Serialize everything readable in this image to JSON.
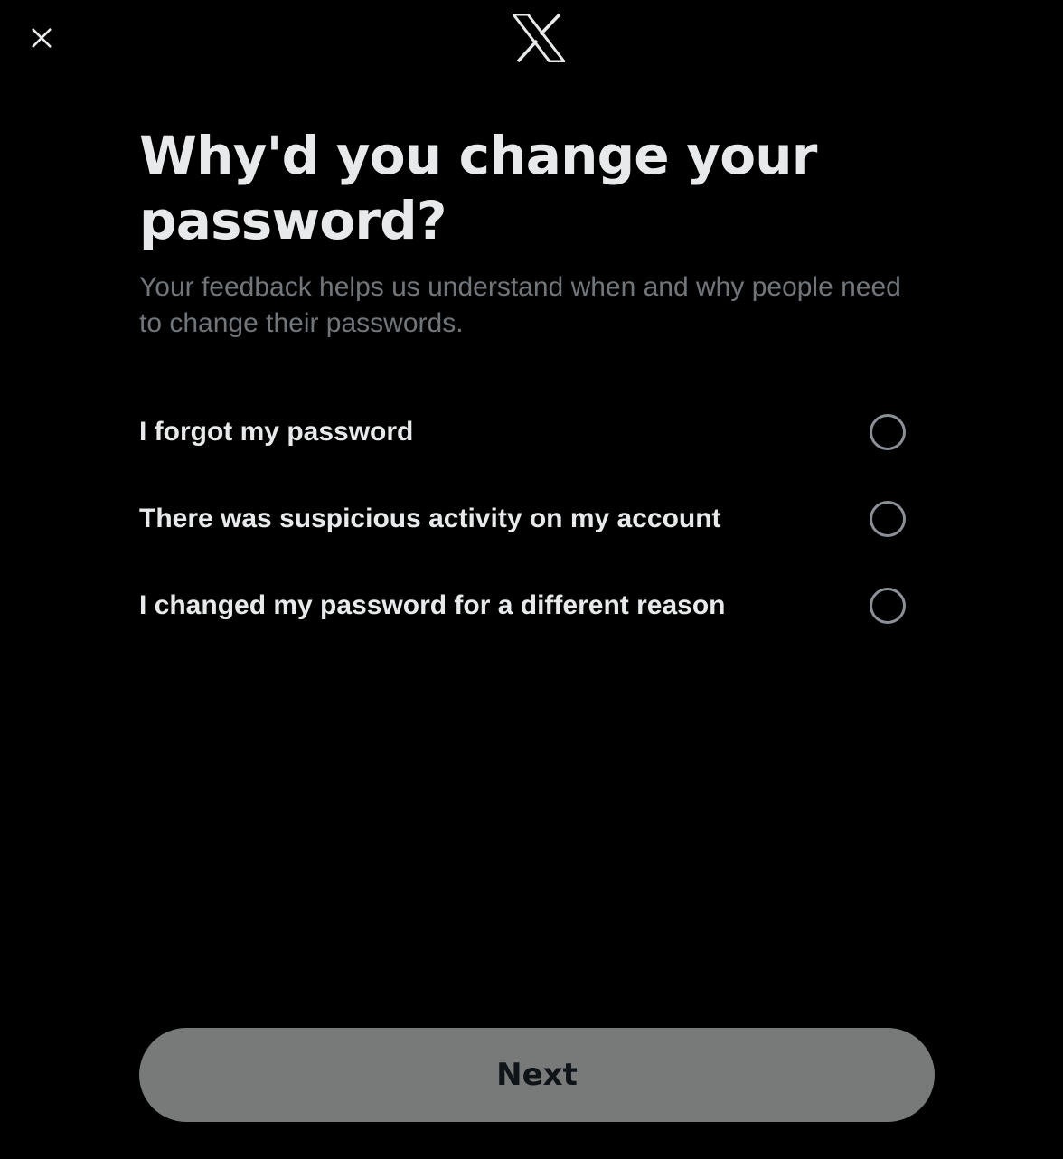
{
  "header": {
    "close_icon": "close-icon",
    "logo_icon": "x-logo-icon"
  },
  "main": {
    "title": "Why'd you change your password?",
    "subtitle": "Your feedback helps us understand when and why people need to change their passwords.",
    "options": [
      {
        "label": "I forgot my password",
        "selected": false
      },
      {
        "label": "There was suspicious activity on my account",
        "selected": false
      },
      {
        "label": "I changed my password for a different reason",
        "selected": false
      }
    ]
  },
  "footer": {
    "next_label": "Next"
  },
  "colors": {
    "background": "#000000",
    "text_primary": "#e7e9ea",
    "text_secondary": "#71767b",
    "radio_border": "#8b9096",
    "button_disabled_bg": "#787a7a",
    "button_text": "#0f1419"
  }
}
